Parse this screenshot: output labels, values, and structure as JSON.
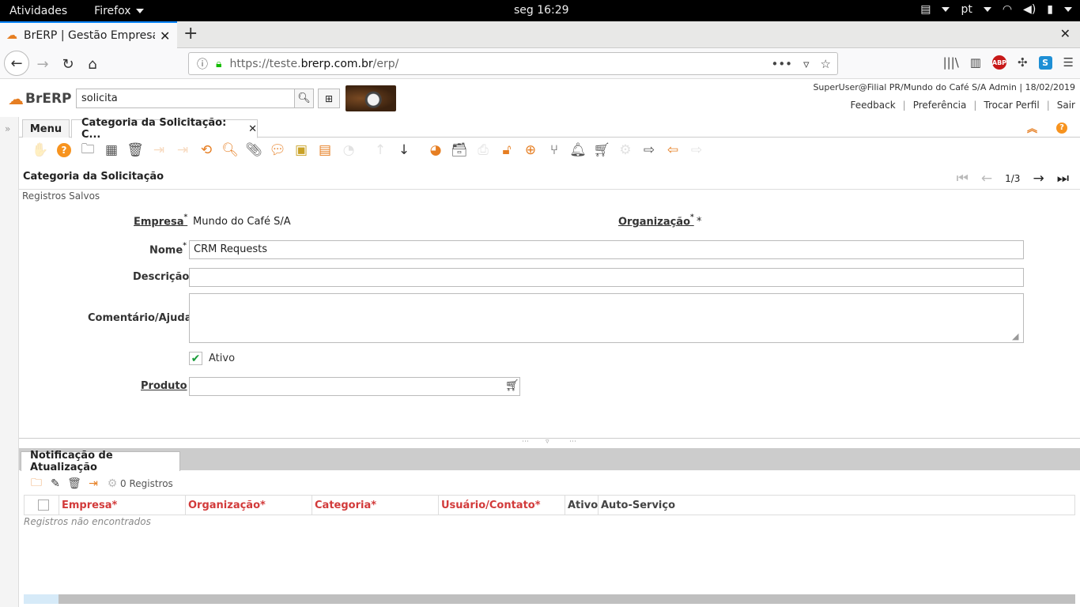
{
  "gnome": {
    "activities": "Atividades",
    "app_name": "Firefox",
    "clock": "seg 16:29",
    "lang": "pt"
  },
  "browser": {
    "tab_title": "BrERP | Gestão Empresarial",
    "url_prefix": "https://teste.",
    "url_domain": "brerp.com.br",
    "url_path": "/erp/"
  },
  "app": {
    "logo_text": "BrERP",
    "search_value": "solicita",
    "user_info": "SuperUser@Filial PR/Mundo do Café S/A Admin | 18/02/2019",
    "links": [
      "Feedback",
      "Preferência",
      "Trocar Perfil",
      "Sair"
    ],
    "menu_tab": "Menu",
    "window_tab": "Categoria da Solicitação: C...",
    "window_title": "Categoria da Solicitação",
    "record_nav": "1/3",
    "status": "Registros Salvos"
  },
  "form": {
    "empresa_label": "Empresa",
    "empresa_value": "Mundo do Café S/A",
    "organizacao_label": "Organização",
    "organizacao_value": "*",
    "nome_label": "Nome",
    "nome_value": "CRM Requests",
    "descricao_label": "Descrição",
    "descricao_value": "",
    "comentario_label": "Comentário/Ajuda",
    "comentario_value": "",
    "ativo_label": "Ativo",
    "ativo_checked": true,
    "produto_label": "Produto",
    "produto_value": ""
  },
  "detail": {
    "tab": "Notificação de Atualização",
    "records": "0 Registros",
    "columns": [
      "Empresa*",
      "Organização*",
      "Categoria*",
      "Usuário/Contato*",
      "Ativo",
      "Auto-Serviço"
    ],
    "empty_text": "Registros não encontrados"
  }
}
